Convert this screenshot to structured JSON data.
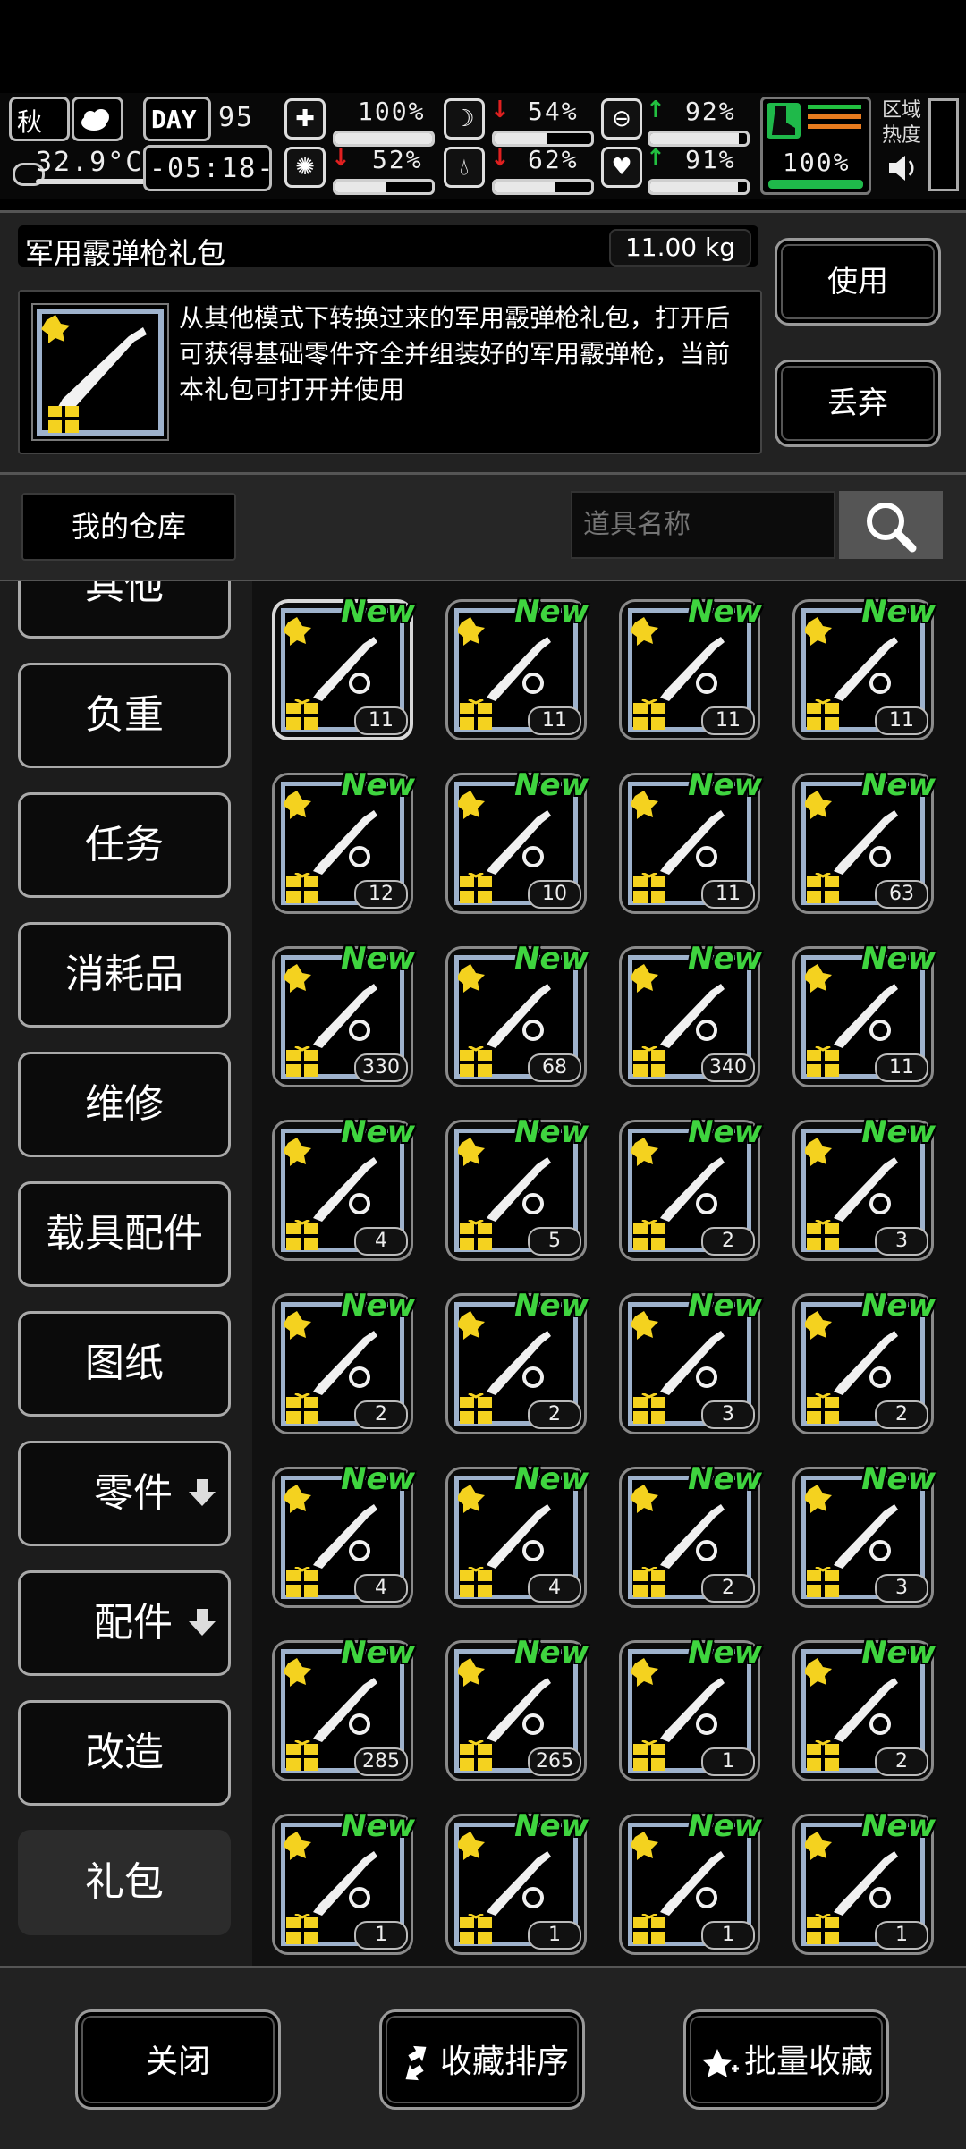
{
  "hud": {
    "season": "秋",
    "temperature": "32.9°C",
    "day_label": "DAY",
    "day_number": "95",
    "clock": "-05:18-",
    "stats": [
      {
        "name": "health",
        "icon": "medkit-icon",
        "value": "100%",
        "level": 1.0,
        "trend": ""
      },
      {
        "name": "hunger",
        "icon": "stomach-icon",
        "value": "54%",
        "level": 0.54,
        "trend": "down"
      },
      {
        "name": "stamina",
        "icon": "pill-icon",
        "value": "92%",
        "level": 0.92,
        "trend": "up"
      },
      {
        "name": "mind",
        "icon": "brain-icon",
        "value": "52%",
        "level": 0.52,
        "trend": "down"
      },
      {
        "name": "thirst",
        "icon": "water-drop-icon",
        "value": "62%",
        "level": 0.62,
        "trend": "down"
      },
      {
        "name": "mood",
        "icon": "heart-icon",
        "value": "91%",
        "level": 0.91,
        "trend": "up"
      }
    ],
    "boot_value": "100%",
    "boot_level": 1.0,
    "zone_heat_label": "区域热度",
    "colors": {
      "accent_green": "#22c040",
      "down_red": "#e02020",
      "bar_orange": "#e87b1e"
    }
  },
  "detail": {
    "item_name": "军用霰弹枪礼包",
    "weight": "11.00 kg",
    "description": "从其他模式下转换过来的军用霰弹枪礼包，打开后可获得基础零件齐全并组装好的军用霰弹枪，当前本礼包可打开并使用",
    "use_label": "使用",
    "discard_label": "丢弃"
  },
  "warehouse": {
    "my_warehouse_label": "我的仓库",
    "search_placeholder": "道具名称"
  },
  "categories": [
    {
      "label": "其他",
      "has_submenu": false,
      "active": false
    },
    {
      "label": "负重",
      "has_submenu": false,
      "active": false
    },
    {
      "label": "任务",
      "has_submenu": false,
      "active": false
    },
    {
      "label": "消耗品",
      "has_submenu": false,
      "active": false
    },
    {
      "label": "维修",
      "has_submenu": false,
      "active": false
    },
    {
      "label": "载具配件",
      "has_submenu": false,
      "active": false
    },
    {
      "label": "图纸",
      "has_submenu": false,
      "active": false
    },
    {
      "label": "零件",
      "has_submenu": true,
      "active": false
    },
    {
      "label": "配件",
      "has_submenu": true,
      "active": false
    },
    {
      "label": "改造",
      "has_submenu": false,
      "active": false
    },
    {
      "label": "礼包",
      "has_submenu": false,
      "active": true
    }
  ],
  "items": [
    {
      "art": "shotgun-icon",
      "new": "New",
      "count": "11",
      "selected": true
    },
    {
      "art": "spear-icon",
      "new": "New",
      "count": "11"
    },
    {
      "art": "assault-rifle-icon",
      "new": "New",
      "count": "11"
    },
    {
      "art": "sniper-rifle-icon",
      "new": "New",
      "count": "11"
    },
    {
      "art": "chainsaw-icon",
      "new": "New",
      "count": "12"
    },
    {
      "art": "axe-icon",
      "new": "New",
      "count": "10"
    },
    {
      "art": "compound-bow-icon",
      "new": "New",
      "count": "11"
    },
    {
      "art": "grenade-icon",
      "new": "New",
      "count": "63"
    },
    {
      "art": "ammo-clip-icon",
      "new": "New",
      "count": "330"
    },
    {
      "art": "fire-canister-icon",
      "new": "New",
      "count": "68"
    },
    {
      "art": "rocket-icon",
      "new": "New",
      "count": "340"
    },
    {
      "art": "machete-icon",
      "new": "New",
      "count": "11"
    },
    {
      "art": "knee-pads-icon",
      "new": "New",
      "count": "4"
    },
    {
      "art": "armor-plate-icon",
      "new": "New",
      "count": "5"
    },
    {
      "art": "gloves-icon",
      "new": "New",
      "count": "2"
    },
    {
      "art": "tactical-vest-icon",
      "new": "New",
      "count": "3"
    },
    {
      "art": "tactical-helmet-icon",
      "new": "New",
      "count": "2"
    },
    {
      "art": "shoulder-armor-icon",
      "new": "New",
      "count": "2"
    },
    {
      "art": "backpack-icon",
      "new": "New",
      "count": "3"
    },
    {
      "art": "leg-armor-icon",
      "new": "New",
      "count": "2"
    },
    {
      "art": "arm-guards-icon",
      "new": "New",
      "count": "4"
    },
    {
      "art": "gas-mask-icon",
      "new": "New",
      "count": "4"
    },
    {
      "art": "body-armor-icon",
      "new": "New",
      "count": "2"
    },
    {
      "art": "riot-shield-icon",
      "new": "New",
      "count": "3"
    },
    {
      "art": "camo-helmet-net-icon",
      "new": "New",
      "count": "285"
    },
    {
      "art": "ghillie-net-icon",
      "new": "New",
      "count": "265"
    },
    {
      "art": "headset-helmet-icon",
      "new": "New",
      "count": "1"
    },
    {
      "art": "rope-coil-icon",
      "new": "New",
      "count": "2"
    },
    {
      "art": "crossbow-bolt-icon",
      "new": "New",
      "count": "1"
    },
    {
      "art": "work-gloves-icon",
      "new": "New",
      "count": "1"
    },
    {
      "art": "mounted-gun-icon",
      "new": "New",
      "count": "1"
    },
    {
      "art": "tripod-gun-icon",
      "new": "New",
      "count": "1"
    }
  ],
  "bottom": {
    "close_label": "关闭",
    "sort_favorites_label": "收藏排序",
    "batch_favorite_label": "批量收藏"
  }
}
